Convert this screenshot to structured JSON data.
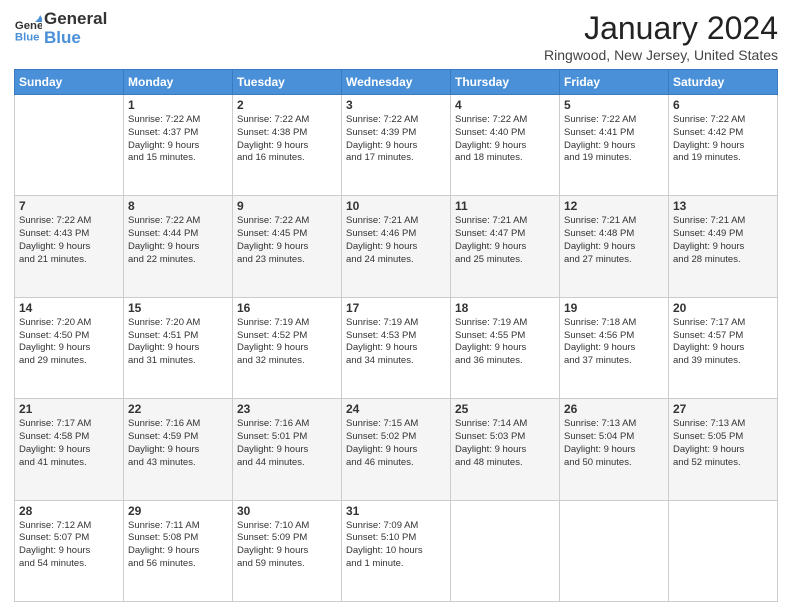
{
  "header": {
    "logo_line1": "General",
    "logo_line2": "Blue",
    "month": "January 2024",
    "location": "Ringwood, New Jersey, United States"
  },
  "weekdays": [
    "Sunday",
    "Monday",
    "Tuesday",
    "Wednesday",
    "Thursday",
    "Friday",
    "Saturday"
  ],
  "weeks": [
    [
      {
        "day": "",
        "text": ""
      },
      {
        "day": "1",
        "text": "Sunrise: 7:22 AM\nSunset: 4:37 PM\nDaylight: 9 hours\nand 15 minutes."
      },
      {
        "day": "2",
        "text": "Sunrise: 7:22 AM\nSunset: 4:38 PM\nDaylight: 9 hours\nand 16 minutes."
      },
      {
        "day": "3",
        "text": "Sunrise: 7:22 AM\nSunset: 4:39 PM\nDaylight: 9 hours\nand 17 minutes."
      },
      {
        "day": "4",
        "text": "Sunrise: 7:22 AM\nSunset: 4:40 PM\nDaylight: 9 hours\nand 18 minutes."
      },
      {
        "day": "5",
        "text": "Sunrise: 7:22 AM\nSunset: 4:41 PM\nDaylight: 9 hours\nand 19 minutes."
      },
      {
        "day": "6",
        "text": "Sunrise: 7:22 AM\nSunset: 4:42 PM\nDaylight: 9 hours\nand 19 minutes."
      }
    ],
    [
      {
        "day": "7",
        "text": "Sunrise: 7:22 AM\nSunset: 4:43 PM\nDaylight: 9 hours\nand 21 minutes."
      },
      {
        "day": "8",
        "text": "Sunrise: 7:22 AM\nSunset: 4:44 PM\nDaylight: 9 hours\nand 22 minutes."
      },
      {
        "day": "9",
        "text": "Sunrise: 7:22 AM\nSunset: 4:45 PM\nDaylight: 9 hours\nand 23 minutes."
      },
      {
        "day": "10",
        "text": "Sunrise: 7:21 AM\nSunset: 4:46 PM\nDaylight: 9 hours\nand 24 minutes."
      },
      {
        "day": "11",
        "text": "Sunrise: 7:21 AM\nSunset: 4:47 PM\nDaylight: 9 hours\nand 25 minutes."
      },
      {
        "day": "12",
        "text": "Sunrise: 7:21 AM\nSunset: 4:48 PM\nDaylight: 9 hours\nand 27 minutes."
      },
      {
        "day": "13",
        "text": "Sunrise: 7:21 AM\nSunset: 4:49 PM\nDaylight: 9 hours\nand 28 minutes."
      }
    ],
    [
      {
        "day": "14",
        "text": "Sunrise: 7:20 AM\nSunset: 4:50 PM\nDaylight: 9 hours\nand 29 minutes."
      },
      {
        "day": "15",
        "text": "Sunrise: 7:20 AM\nSunset: 4:51 PM\nDaylight: 9 hours\nand 31 minutes."
      },
      {
        "day": "16",
        "text": "Sunrise: 7:19 AM\nSunset: 4:52 PM\nDaylight: 9 hours\nand 32 minutes."
      },
      {
        "day": "17",
        "text": "Sunrise: 7:19 AM\nSunset: 4:53 PM\nDaylight: 9 hours\nand 34 minutes."
      },
      {
        "day": "18",
        "text": "Sunrise: 7:19 AM\nSunset: 4:55 PM\nDaylight: 9 hours\nand 36 minutes."
      },
      {
        "day": "19",
        "text": "Sunrise: 7:18 AM\nSunset: 4:56 PM\nDaylight: 9 hours\nand 37 minutes."
      },
      {
        "day": "20",
        "text": "Sunrise: 7:17 AM\nSunset: 4:57 PM\nDaylight: 9 hours\nand 39 minutes."
      }
    ],
    [
      {
        "day": "21",
        "text": "Sunrise: 7:17 AM\nSunset: 4:58 PM\nDaylight: 9 hours\nand 41 minutes."
      },
      {
        "day": "22",
        "text": "Sunrise: 7:16 AM\nSunset: 4:59 PM\nDaylight: 9 hours\nand 43 minutes."
      },
      {
        "day": "23",
        "text": "Sunrise: 7:16 AM\nSunset: 5:01 PM\nDaylight: 9 hours\nand 44 minutes."
      },
      {
        "day": "24",
        "text": "Sunrise: 7:15 AM\nSunset: 5:02 PM\nDaylight: 9 hours\nand 46 minutes."
      },
      {
        "day": "25",
        "text": "Sunrise: 7:14 AM\nSunset: 5:03 PM\nDaylight: 9 hours\nand 48 minutes."
      },
      {
        "day": "26",
        "text": "Sunrise: 7:13 AM\nSunset: 5:04 PM\nDaylight: 9 hours\nand 50 minutes."
      },
      {
        "day": "27",
        "text": "Sunrise: 7:13 AM\nSunset: 5:05 PM\nDaylight: 9 hours\nand 52 minutes."
      }
    ],
    [
      {
        "day": "28",
        "text": "Sunrise: 7:12 AM\nSunset: 5:07 PM\nDaylight: 9 hours\nand 54 minutes."
      },
      {
        "day": "29",
        "text": "Sunrise: 7:11 AM\nSunset: 5:08 PM\nDaylight: 9 hours\nand 56 minutes."
      },
      {
        "day": "30",
        "text": "Sunrise: 7:10 AM\nSunset: 5:09 PM\nDaylight: 9 hours\nand 59 minutes."
      },
      {
        "day": "31",
        "text": "Sunrise: 7:09 AM\nSunset: 5:10 PM\nDaylight: 10 hours\nand 1 minute."
      },
      {
        "day": "",
        "text": ""
      },
      {
        "day": "",
        "text": ""
      },
      {
        "day": "",
        "text": ""
      }
    ]
  ]
}
